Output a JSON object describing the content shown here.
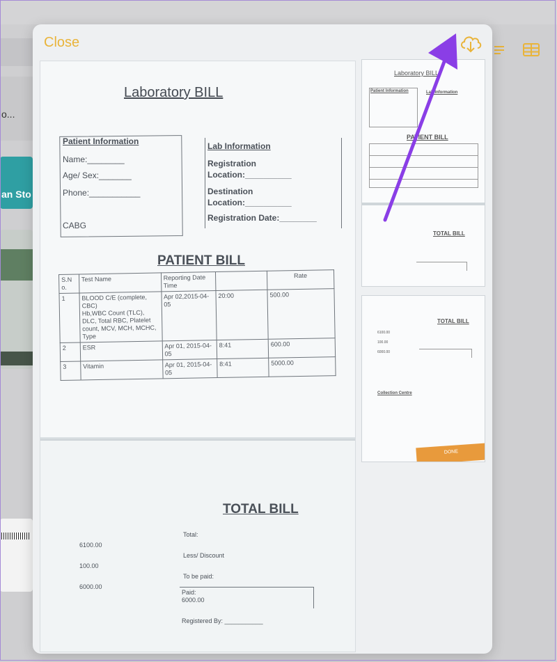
{
  "modal": {
    "close_label": "Close"
  },
  "background": {
    "snippet_text": "o...",
    "label_fragment": "an Sto"
  },
  "document": {
    "title": "Laboratory BILL",
    "patient_info": {
      "heading": "Patient Information",
      "name": "Name:________",
      "age_sex": "Age/ Sex:_______",
      "phone": "Phone:___________",
      "procedure": "CABG"
    },
    "lab_info": {
      "heading": "Lab Information",
      "registration_location": "Registration\nLocation:__________",
      "destination_location": "Destination\nLocation:__________",
      "registration_date": "Registration Date:________"
    },
    "patient_bill_heading": "PATIENT BILL",
    "table": {
      "headers": [
        "S.N o.",
        "Test Name",
        "Reporting Date Time",
        "",
        "Rate"
      ],
      "rows": [
        [
          "1",
          "BLOOD C/E (complete, CBC)\nHb,WBC Count (TLC), DLC, Total RBC, Platelet count,  MCV, MCH, MCHC, Type",
          "Apr 02,2015-04-05",
          "20:00",
          "500.00"
        ],
        [
          "2",
          "ESR",
          "Apr 01, 2015-04-05",
          "8:41",
          "600.00"
        ],
        [
          "3",
          "Vitamin",
          "Apr 01, 2015-04-05",
          "8:41",
          "5000.00"
        ]
      ]
    },
    "total_bill": {
      "heading": "TOTAL BILL",
      "values": [
        "6100.00",
        "100.00",
        "6000.00"
      ],
      "labels": [
        "Total:",
        "Less/ Discount",
        "To be paid:"
      ],
      "paid_label": "Paid:",
      "paid_value": "6000.00",
      "registered_by": "Registered By: ___________"
    }
  },
  "thumbnails": {
    "thumb1": {
      "title": "Laboratory BILL",
      "patient_heading": "Patient Information",
      "lab_heading": "Lab Information",
      "bill_heading": "PATIENT BILL",
      "total_heading": "TOTAL BILL"
    },
    "thumb2": {
      "total_heading": "TOTAL BILL",
      "values": [
        "6100.00",
        "100.00",
        "6000.00"
      ],
      "collection_heading": "Collection Centre",
      "footer_label": "DONE"
    }
  },
  "colors": {
    "accent": "#e9b43a",
    "arrow": "#8a3ee6",
    "modal_bg": "#eef0f2"
  },
  "icons": {
    "download": "cloud-download-icon",
    "list": "list-icon",
    "table": "table-icon"
  }
}
